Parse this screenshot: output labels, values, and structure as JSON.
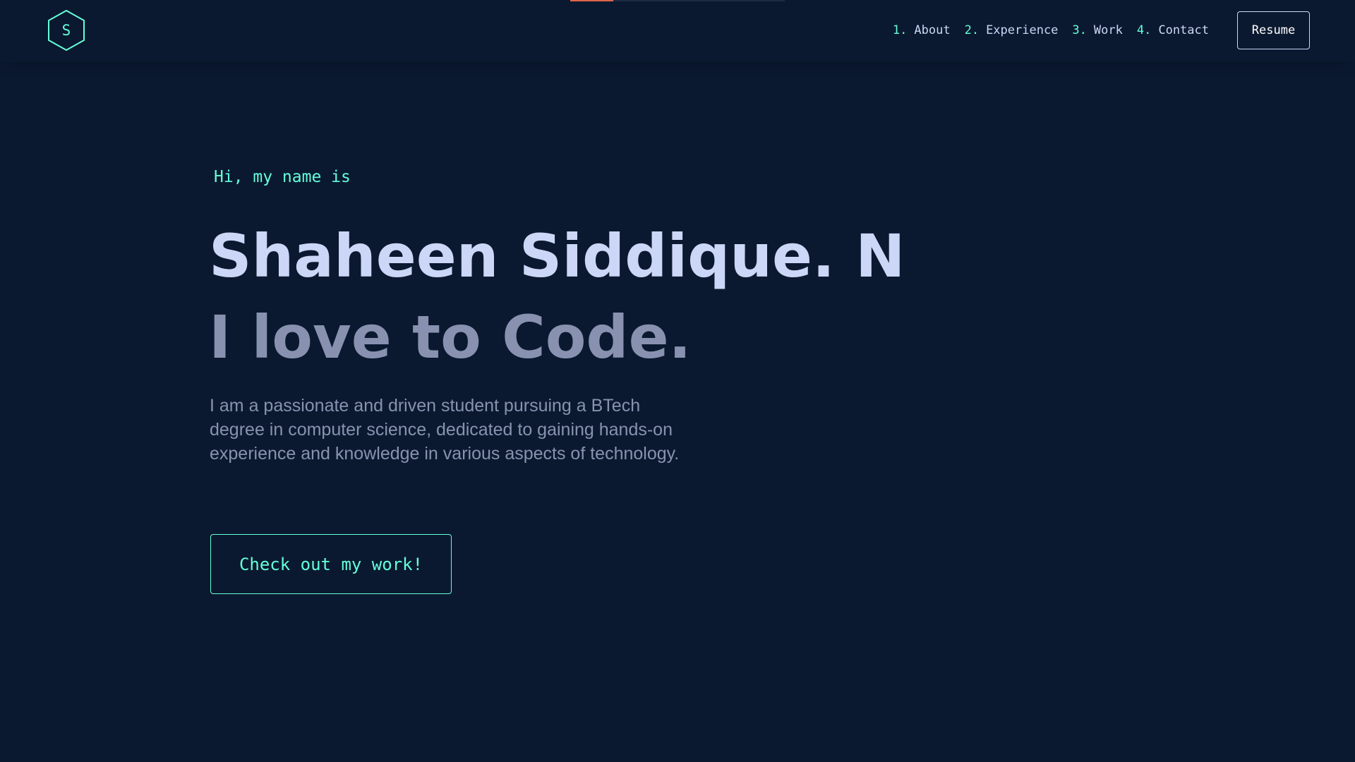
{
  "colors": {
    "background": "#0b1930",
    "accent": "#64ffda",
    "heading": "#ccd6f6",
    "muted": "#8892b0",
    "progress": "#e0634b"
  },
  "scroll_progress": 0.2,
  "header": {
    "logo": {
      "letter": "S",
      "icon": "hexagon-logo-icon"
    },
    "nav": [
      {
        "number": "1.",
        "label": "About"
      },
      {
        "number": "2.",
        "label": "Experience"
      },
      {
        "number": "3.",
        "label": "Work"
      },
      {
        "number": "4.",
        "label": "Contact"
      }
    ],
    "resume_label": "Resume"
  },
  "hero": {
    "intro": "Hi, my name is",
    "name": "Shaheen Siddique. N",
    "tagline": "I love to Code.",
    "bio": "I am a passionate and driven student pursuing a BTech degree in computer science, dedicated to gaining hands-on experience and knowledge in various aspects of technology.",
    "cta_label": "Check out my work!"
  }
}
